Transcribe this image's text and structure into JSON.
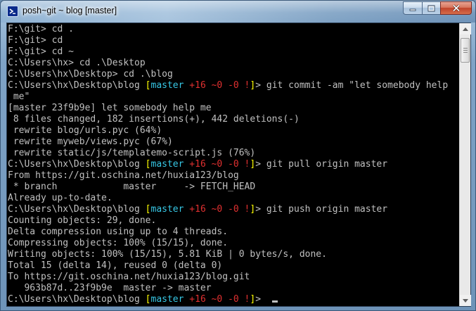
{
  "window": {
    "title": "posh~git ~ blog [master]",
    "caption_buttons": {
      "minimize": "minimize-icon",
      "maximize": "maximize-icon",
      "close": "close-icon"
    }
  },
  "colors": {
    "branch": "#37c8e6",
    "status": "#e03030",
    "bracket": "#ffff00",
    "text": "#c0c0c0"
  },
  "prompt": {
    "path": "C:\\Users\\hx\\Desktop\\blog",
    "open": "[",
    "branch": "master",
    "status": "+16 ~0 -0 !",
    "close": "]",
    "suffix": "> "
  },
  "terminal": {
    "lines": [
      "F:\\git> cd .",
      "F:\\git> cd",
      "F:\\git> cd ~",
      "C:\\Users\\hx> cd .\\Desktop",
      "C:\\Users\\hx\\Desktop> cd .\\blog",
      {
        "prompt": true,
        "cmd": "git commit -am \"let somebody help"
      },
      " me\"",
      "[master 23f9b9e] let somebody help me",
      " 8 files changed, 182 insertions(+), 442 deletions(-)",
      " rewrite blog/urls.pyc (64%)",
      " rewrite myweb/views.pyc (67%)",
      " rewrite static/js/templatemo-script.js (76%)",
      {
        "prompt": true,
        "cmd": "git pull origin master"
      },
      "From https://git.oschina.net/huxia123/blog",
      " * branch            master     -> FETCH_HEAD",
      "Already up-to-date.",
      {
        "prompt": true,
        "cmd": "git push origin master"
      },
      "Counting objects: 29, done.",
      "Delta compression using up to 4 threads.",
      "Compressing objects: 100% (15/15), done.",
      "Writing objects: 100% (15/15), 5.81 KiB | 0 bytes/s, done.",
      "Total 15 (delta 14), reused 0 (delta 0)",
      "To https://git.oschina.net/huxia123/blog.git",
      "   963b87d..23f9b9e  master -> master",
      {
        "prompt": true,
        "cmd": "",
        "cursor": true
      }
    ]
  }
}
